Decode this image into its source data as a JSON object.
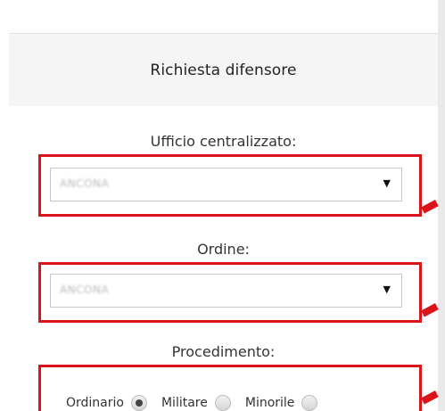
{
  "header": {
    "title": "Richiesta difensore"
  },
  "form": {
    "ufficio": {
      "label": "Ufficio centralizzato:",
      "value": "ANCONA"
    },
    "ordine": {
      "label": "Ordine:",
      "value": "ANCONA"
    },
    "procedimento": {
      "label": "Procedimento:",
      "options": [
        {
          "label": "Ordinario",
          "checked": true
        },
        {
          "label": "Militare",
          "checked": false
        },
        {
          "label": "Minorile",
          "checked": false
        }
      ]
    }
  },
  "colors": {
    "highlight": "#d9141a",
    "header_bg": "#f5f5f5"
  },
  "icons": {
    "select_caret": "caret-down-icon"
  }
}
